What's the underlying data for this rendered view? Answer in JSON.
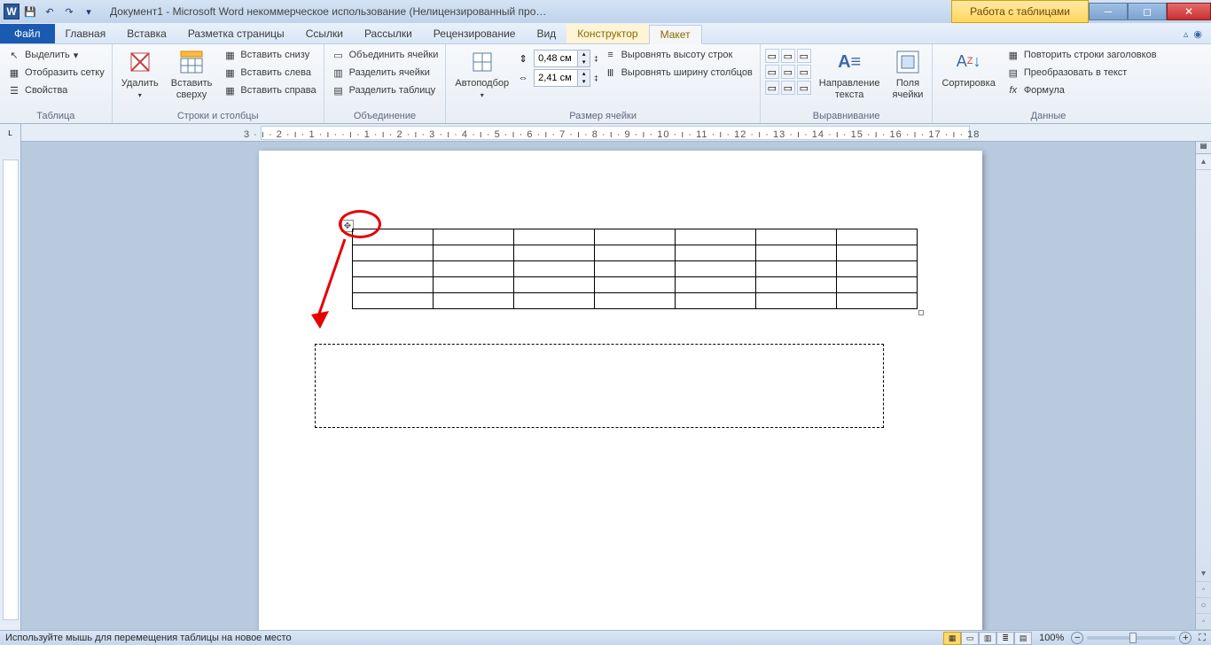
{
  "title": "Документ1 - Microsoft Word некоммерческое использование (Нелицензированный про…",
  "tools_context": "Работа с таблицами",
  "tabs": {
    "file": "Файл",
    "items": [
      "Главная",
      "Вставка",
      "Разметка страницы",
      "Ссылки",
      "Рассылки",
      "Рецензирование",
      "Вид"
    ],
    "context": [
      "Конструктор",
      "Макет"
    ],
    "active": "Макет"
  },
  "ribbon": {
    "table": {
      "select": "Выделить",
      "grid": "Отобразить сетку",
      "props": "Свойства",
      "label": "Таблица"
    },
    "rows": {
      "delete": "Удалить",
      "insert_above": "Вставить\nсверху",
      "below": "Вставить снизу",
      "left": "Вставить слева",
      "right": "Вставить справа",
      "label": "Строки и столбцы"
    },
    "merge": {
      "merge": "Объединить ячейки",
      "split": "Разделить ячейки",
      "split_table": "Разделить таблицу",
      "label": "Объединение"
    },
    "size": {
      "autofit": "Автоподбор",
      "h": "0,48 см",
      "w": "2,41 см",
      "eq_h": "Выровнять высоту строк",
      "eq_w": "Выровнять ширину столбцов",
      "label": "Размер ячейки"
    },
    "align": {
      "dir": "Направление\nтекста",
      "margins": "Поля\nячейки",
      "label": "Выравнивание"
    },
    "data": {
      "sort": "Сортировка",
      "repeat": "Повторить строки заголовков",
      "convert": "Преобразовать в текст",
      "formula": "Формула",
      "label": "Данные"
    }
  },
  "status": {
    "msg": "Используйте мышь для перемещения таблицы на новое место",
    "zoom": "100%"
  },
  "ruler": "3 · ı · 2 · ı · 1 · ı ·   · ı · 1 · ı · 2 · ı · 3 · ı · 4 · ı · 5 · ı · 6 · ı · 7 · ı · 8 · ı · 9 · ı · 10 · ı · 11 · ı · 12 · ı · 13 · ı · 14 · ı · 15 · ı · 16 · ı · 17 · ı · 18"
}
